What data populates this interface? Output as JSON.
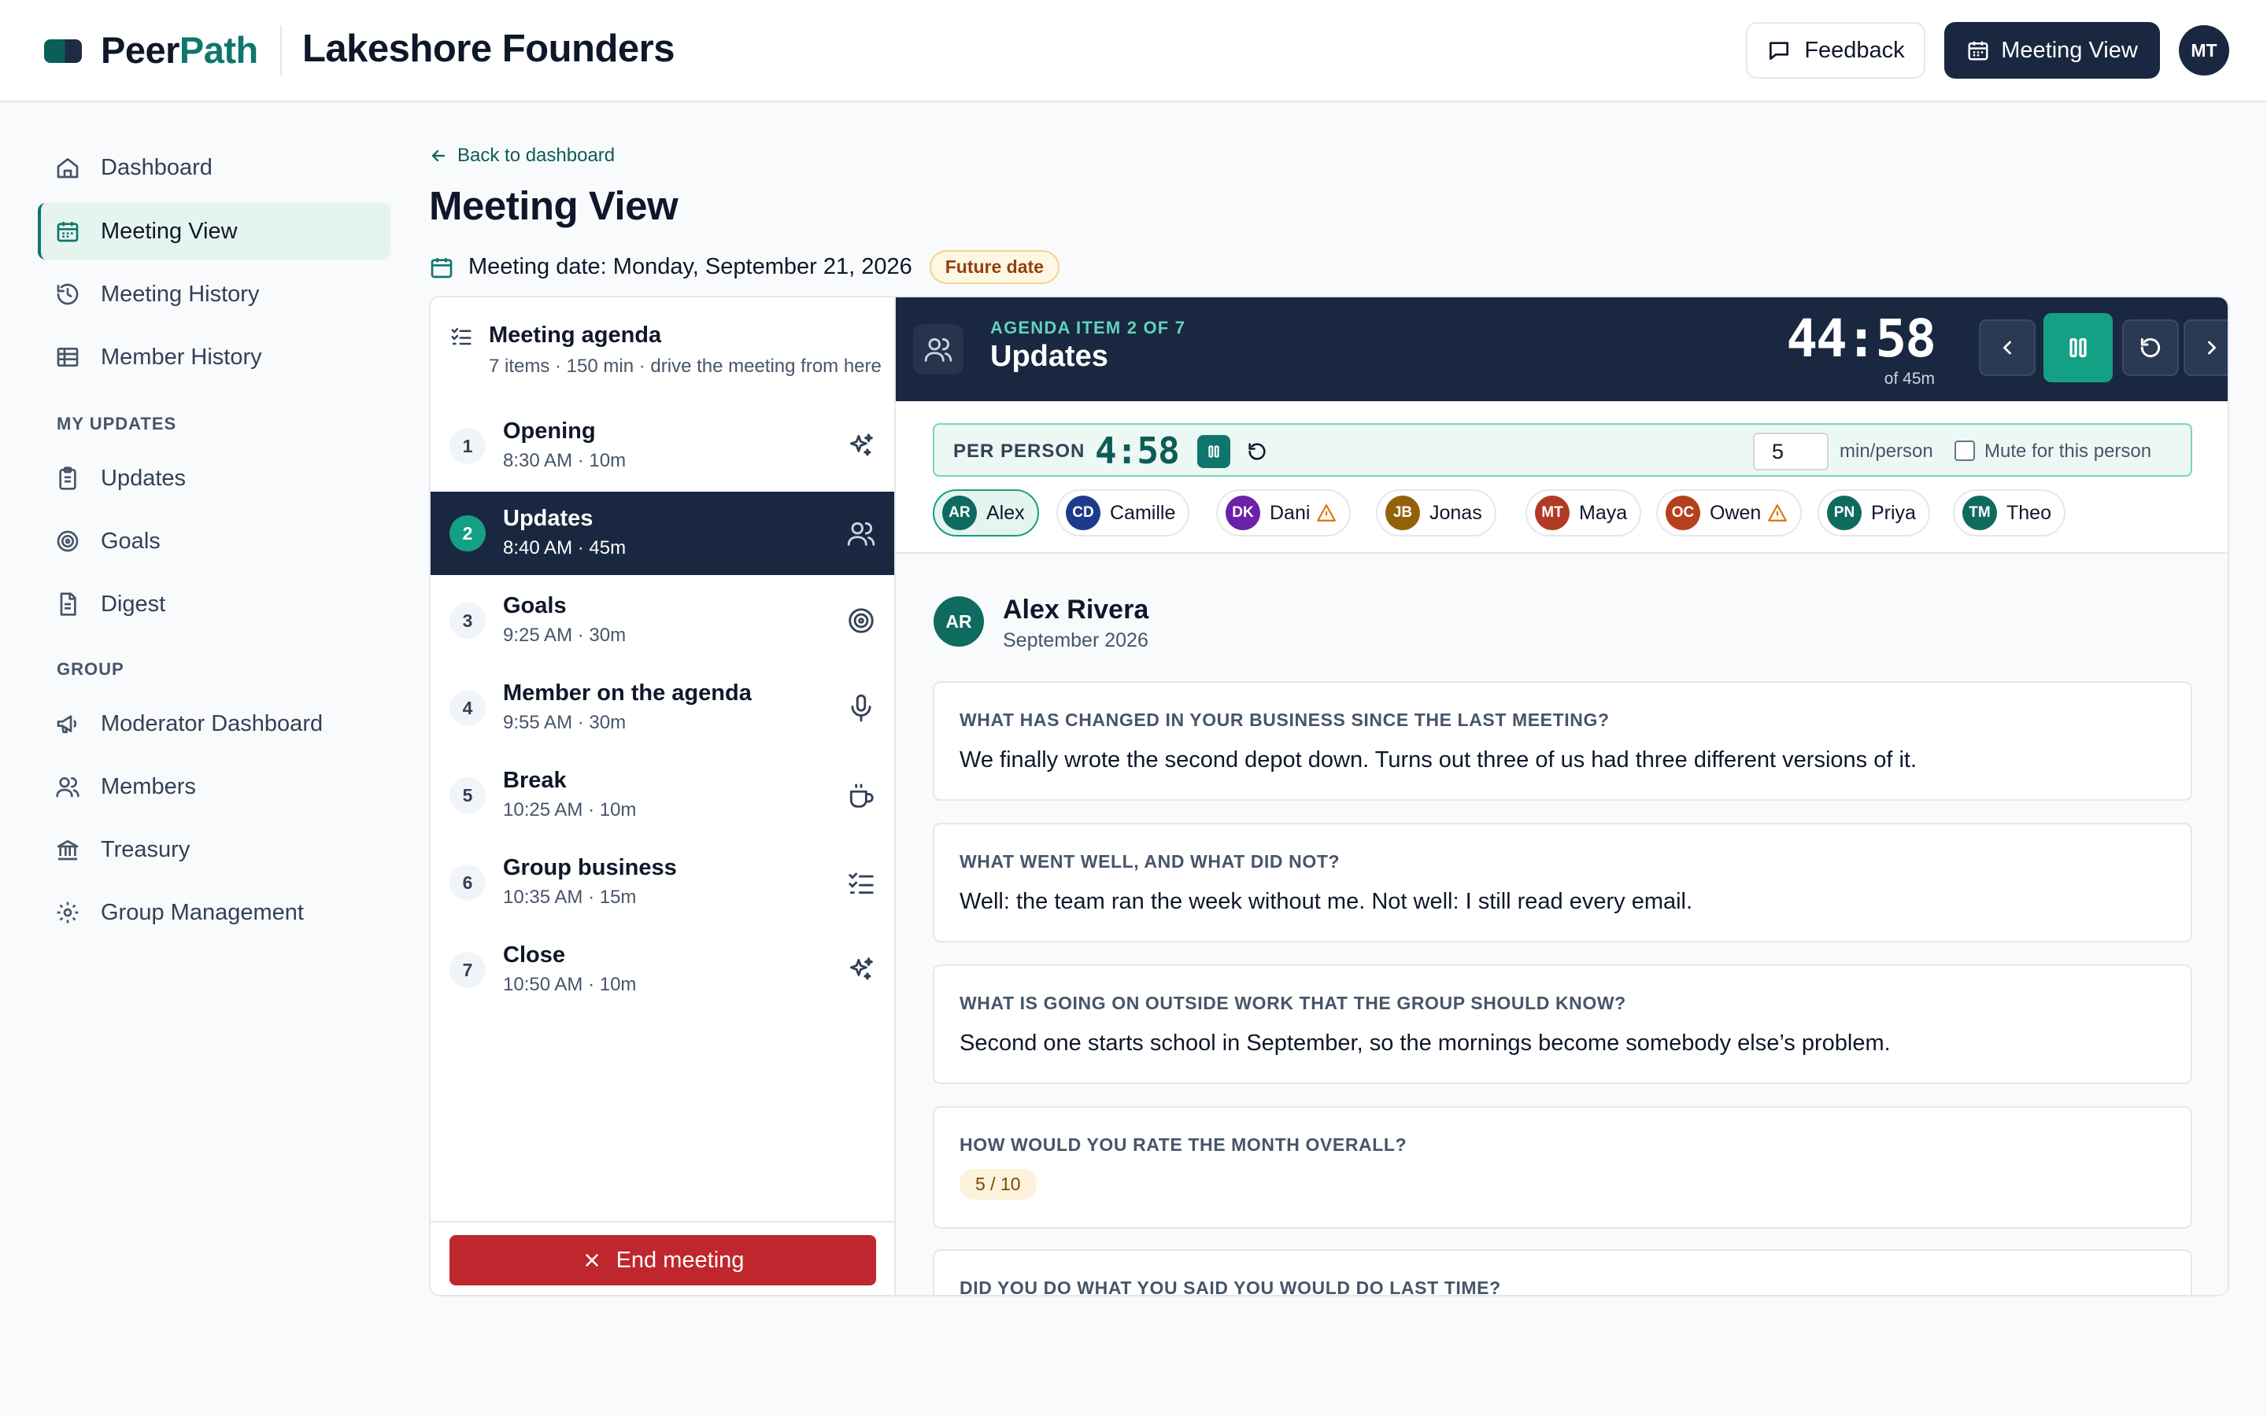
{
  "header": {
    "brand_part1": "Peer",
    "brand_part2": "Path",
    "org_name": "Lakeshore Founders",
    "feedback_label": "Feedback",
    "meeting_view_label": "Meeting View",
    "user_initials": "MT"
  },
  "sidebar": {
    "items": [
      {
        "label": "Dashboard",
        "icon": "home-icon"
      },
      {
        "label": "Meeting View",
        "icon": "calendar-icon",
        "active": true
      },
      {
        "label": "Meeting History",
        "icon": "history-icon"
      },
      {
        "label": "Member History",
        "icon": "table-icon"
      }
    ],
    "section_my_updates": "MY UPDATES",
    "my_updates": [
      {
        "label": "Updates",
        "icon": "clipboard-icon"
      },
      {
        "label": "Goals",
        "icon": "target-icon"
      },
      {
        "label": "Digest",
        "icon": "document-icon"
      }
    ],
    "section_group": "GROUP",
    "group": [
      {
        "label": "Moderator Dashboard",
        "icon": "megaphone-icon"
      },
      {
        "label": "Members",
        "icon": "users-icon"
      },
      {
        "label": "Treasury",
        "icon": "bank-icon"
      },
      {
        "label": "Group Management",
        "icon": "gear-icon"
      }
    ]
  },
  "page": {
    "back_label": "Back to dashboard",
    "title": "Meeting View",
    "meeting_date": "Meeting date: Monday, September 21, 2026",
    "date_badge": "Future date"
  },
  "agenda": {
    "title": "Meeting agenda",
    "subtitle": "7 items · 150 min · drive the meeting from here",
    "items": [
      {
        "num": "1",
        "name": "Opening",
        "time": "8:30 AM · 10m",
        "icon": "sparkles-icon"
      },
      {
        "num": "2",
        "name": "Updates",
        "time": "8:40 AM · 45m",
        "icon": "users-icon",
        "active": true
      },
      {
        "num": "3",
        "name": "Goals",
        "time": "9:25 AM · 30m",
        "icon": "target-icon"
      },
      {
        "num": "4",
        "name": "Member on the agenda",
        "time": "9:55 AM · 30m",
        "icon": "microphone-icon"
      },
      {
        "num": "5",
        "name": "Break",
        "time": "10:25 AM · 10m",
        "icon": "coffee-icon"
      },
      {
        "num": "6",
        "name": "Group business",
        "time": "10:35 AM · 15m",
        "icon": "checklist-icon"
      },
      {
        "num": "7",
        "name": "Close",
        "time": "10:50 AM · 10m",
        "icon": "sparkles-icon"
      }
    ],
    "end_label": "End meeting"
  },
  "current": {
    "kicker": "AGENDA ITEM 2 OF 7",
    "title": "Updates",
    "timer": "44:58",
    "timer_of": "of 45m"
  },
  "per_person": {
    "label": "PER PERSON",
    "timer": "4:58",
    "minutes": "5",
    "unit": "min/person",
    "mute_label": "Mute for this person"
  },
  "members": [
    {
      "initials": "AR",
      "name": "Alex",
      "color": "#0f6b5f",
      "active": true,
      "warning": false
    },
    {
      "initials": "CD",
      "name": "Camille",
      "color": "#1e3a8a",
      "warning": false
    },
    {
      "initials": "DK",
      "name": "Dani",
      "color": "#6b21a8",
      "warning": true
    },
    {
      "initials": "JB",
      "name": "Jonas",
      "color": "#92620a",
      "warning": false
    },
    {
      "initials": "MT",
      "name": "Maya",
      "color": "#b23a24",
      "warning": false
    },
    {
      "initials": "OC",
      "name": "Owen",
      "color": "#b5401e",
      "warning": true
    },
    {
      "initials": "PN",
      "name": "Priya",
      "color": "#0f6b5f",
      "warning": false
    },
    {
      "initials": "TM",
      "name": "Theo",
      "color": "#0f6b5f",
      "warning": false
    }
  ],
  "person": {
    "initials": "AR",
    "name": "Alex Rivera",
    "period": "September 2026"
  },
  "questions": [
    {
      "q": "WHAT HAS CHANGED IN YOUR BUSINESS SINCE THE LAST MEETING?",
      "a": "We finally wrote the second depot down. Turns out three of us had three different versions of it."
    },
    {
      "q": "WHAT WENT WELL, AND WHAT DID NOT?",
      "a": "Well: the team ran the week without me. Not well: I still read every email."
    },
    {
      "q": "WHAT IS GOING ON OUTSIDE WORK THAT THE GROUP SHOULD KNOW?",
      "a": "Second one starts school in September, so the mornings become somebody else’s problem."
    },
    {
      "q": "HOW WOULD YOU RATE THE MONTH OVERALL?",
      "rating": "5 / 10"
    },
    {
      "q": "DID YOU DO WHAT YOU SAID YOU WOULD DO LAST TIME?"
    }
  ],
  "colors": {
    "accent": "#0f766e",
    "navy": "#1a2740",
    "danger": "#c0262d",
    "warning": "#d97706"
  }
}
